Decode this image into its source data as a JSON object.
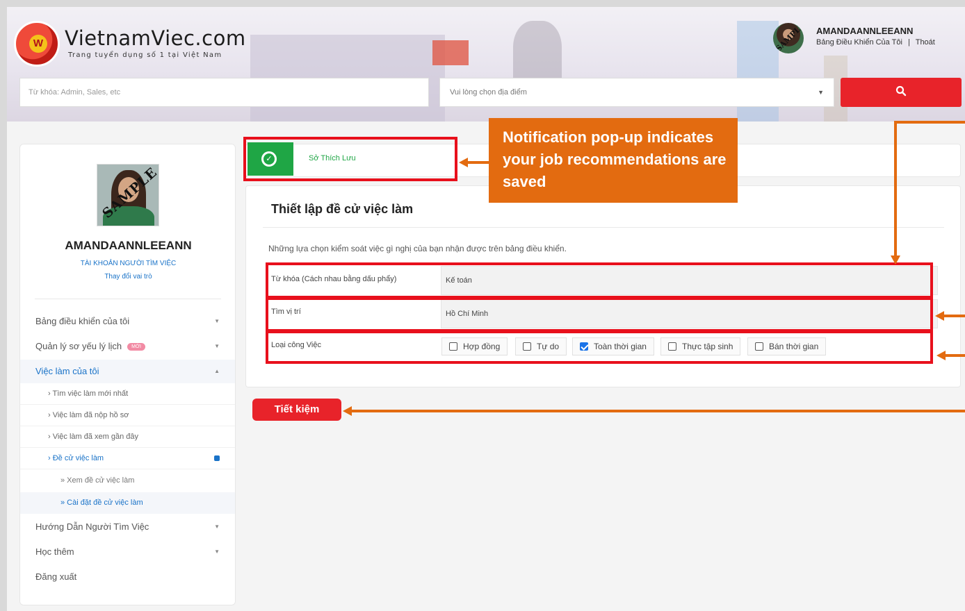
{
  "header": {
    "logo_name": "VietnamViec.com",
    "logo_letter": "W",
    "logo_tagline": "Trang tuyển dụng số 1 tại Việt Nam",
    "avatar_watermark": "SAMPLE",
    "user_name": "AMANDAANNLEEANN",
    "dashboard_link": "Bảng Điều Khiển Của Tôi",
    "link_separator": "|",
    "logout_link": "Thoát"
  },
  "search": {
    "keyword_placeholder": "Từ khóa: Admin, Sales, etc",
    "location_placeholder": "Vui lòng chọn địa điểm",
    "location_caret": "▼",
    "search_icon": "search-icon",
    "search_glyph": "🔍"
  },
  "sidebar": {
    "photo_watermark": "SAMPLE",
    "name": "AMANDAANNLEEANN",
    "role": "TÀI KHOẢN NGƯỜI TÌM VIỆC",
    "change_role": "Thay đổi vai trò",
    "menu": [
      {
        "label": "Bảng điều khiển của tôi",
        "arrow": "▼"
      },
      {
        "label": "Quản lý sơ yếu lý lịch",
        "badge": "MỚI",
        "arrow": "▼"
      },
      {
        "label": "Việc làm của tôi",
        "arrow": "▲"
      },
      {
        "label": "Hướng Dẫn Người Tìm Việc",
        "arrow": "▼"
      },
      {
        "label": "Học thêm",
        "arrow": "▼"
      },
      {
        "label": "Đăng xuất"
      }
    ],
    "submenu": [
      {
        "label": "›  Tìm việc làm mới nhất"
      },
      {
        "label": "›  Việc làm đã nộp hồ sơ"
      },
      {
        "label": "›  Việc làm đã xem gần đây"
      },
      {
        "label": "›  Đề cử việc làm"
      }
    ],
    "subsubmenu": [
      {
        "label": "»  Xem đề cử việc làm"
      },
      {
        "label": "»  Cài đặt đề cử việc làm"
      }
    ]
  },
  "notification": {
    "check_glyph": "✓",
    "text": "Sở Thích Lưu"
  },
  "callout": {
    "text": "Notification pop-up indicates your job recommendations are saved"
  },
  "settings": {
    "title": "Thiết lập đề cử việc làm",
    "description": "Những lựa chọn kiểm soát việc gì nghị của bạn nhận được trên bảng điều khiển.",
    "keyword_label": "Từ khóa (Cách nhau bằng dấu phẩy)",
    "keyword_value": "Kế toán",
    "location_label": "Tìm vị trí",
    "location_value": "Hồ Chí Minh",
    "jobtype_label": "Loại công Việc",
    "job_types": [
      {
        "label": "Hợp đồng",
        "checked": false
      },
      {
        "label": "Tự do",
        "checked": false
      },
      {
        "label": "Toàn thời gian",
        "checked": true
      },
      {
        "label": "Thực tập sinh",
        "checked": false
      },
      {
        "label": "Bán thời gian",
        "checked": false
      }
    ],
    "save_label": "Tiết kiệm"
  },
  "colors": {
    "brand_red": "#e8232a",
    "link_blue": "#1a73c8",
    "success_green": "#1fa645",
    "annotation_orange": "#e36b10",
    "highlight_red": "#e8101c"
  }
}
